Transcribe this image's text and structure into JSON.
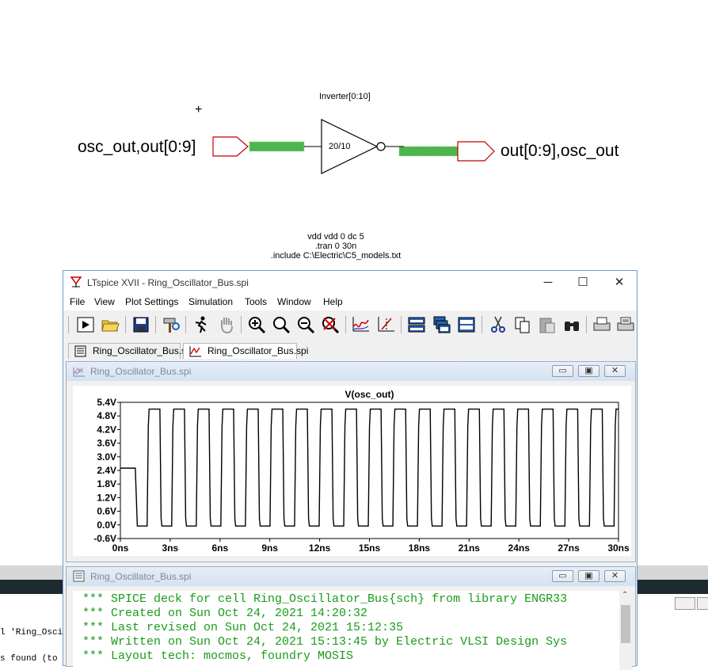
{
  "schematic": {
    "input_label": "osc_out,out[0:9]",
    "output_label": "out[0:9],osc_out",
    "instance_name": "Inverter[0:10]",
    "instance_size": "20/10",
    "spice_lines": [
      "vdd vdd 0 dc 5",
      ".tran 0 30n",
      ".include C:\\Electric\\C5_models.txt"
    ]
  },
  "background_window": {
    "lines": [
      "l 'Ring_Osci",
      "s found (to"
    ]
  },
  "window": {
    "title": "LTspice XVII - Ring_Oscillator_Bus.spi",
    "controls": [
      "─",
      "☐",
      "✕"
    ],
    "menu": [
      "File",
      "View",
      "Plot Settings",
      "Simulation",
      "Tools",
      "Window",
      "Help"
    ],
    "tabs": [
      {
        "label": "Ring_Oscillator_Bus.spi",
        "icon": "netlist-document-icon"
      },
      {
        "label": "Ring_Oscillator_Bus.spi",
        "icon": "waveform-icon"
      }
    ]
  },
  "plot_window": {
    "title": "Ring_Oscillator_Bus.spi",
    "buttons": [
      "▭",
      "▣",
      "✕"
    ]
  },
  "netlist_window": {
    "title": "Ring_Oscillator_Bus.spi",
    "buttons": [
      "▭",
      "▣",
      "✕"
    ],
    "lines": [
      "*** SPICE deck for cell Ring_Oscillator_Bus{sch} from library ENGR33",
      "*** Created on Sun Oct 24, 2021 14:20:32",
      "*** Last revised on Sun Oct 24, 2021 15:12:35",
      "*** Written on Sun Oct 24, 2021 15:13:45 by Electric VLSI Design Sys",
      "*** Layout tech: mocmos, foundry MOSIS"
    ]
  },
  "chart_data": {
    "type": "line",
    "title": "V(osc_out)",
    "xlabel": "",
    "ylabel": "",
    "x_unit": "ns",
    "y_unit": "V",
    "xlim": [
      0,
      30
    ],
    "ylim": [
      -0.6,
      5.4
    ],
    "x_ticks": [
      "0ns",
      "3ns",
      "6ns",
      "9ns",
      "12ns",
      "15ns",
      "18ns",
      "21ns",
      "24ns",
      "27ns",
      "30ns"
    ],
    "y_ticks": [
      "5.4V",
      "4.8V",
      "4.2V",
      "3.6V",
      "3.0V",
      "2.4V",
      "1.8V",
      "1.2V",
      "0.6V",
      "0.0V",
      "-0.6V"
    ],
    "grid": false,
    "color": "#000000",
    "initial_level_V": 2.5,
    "start_time_ns": 0.9,
    "high_V": 5.1,
    "low_V": -0.05,
    "period_ns": 1.48,
    "cycles": 20,
    "series": [
      {
        "values_description": "",
        "x": [
          0,
          0.9,
          1.05,
          1.7,
          1.85,
          2.45
        ],
        "y": [
          2.5,
          2.5,
          -0.05,
          -0.05,
          5.1,
          5.1
        ]
      }
    ]
  }
}
